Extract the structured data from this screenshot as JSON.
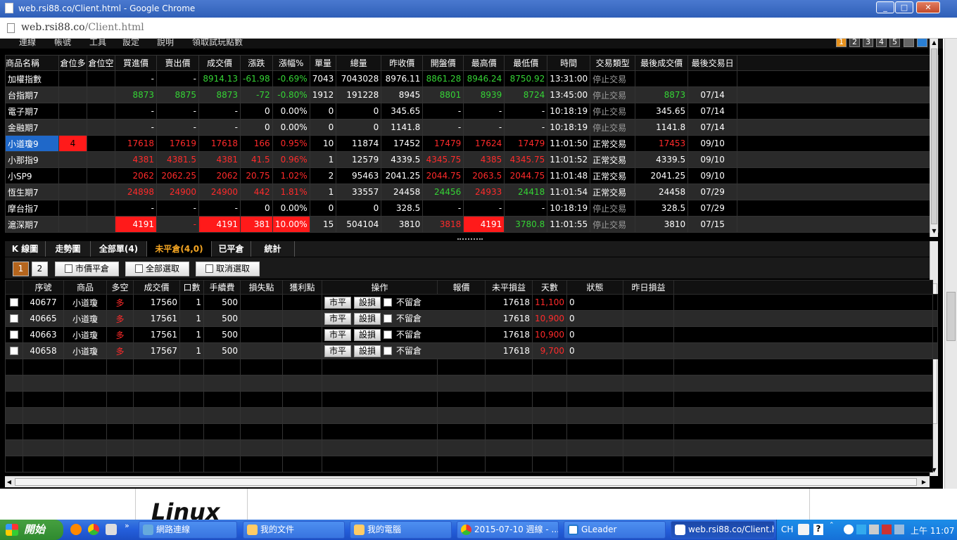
{
  "window": {
    "title": "web.rsi88.co/Client.html - Google Chrome",
    "url_host": "web.rsi88.co",
    "url_path": "/Client.html"
  },
  "menu": {
    "items": [
      "連線",
      "帳號",
      "工具",
      "設定",
      "說明",
      "領取試玩點數"
    ],
    "page_buttons": [
      "1",
      "2",
      "3",
      "4",
      "5"
    ]
  },
  "quotes": {
    "headers": [
      "商品名稱",
      "倉位多",
      "倉位空",
      "買進價",
      "賣出價",
      "成交價",
      "漲跌",
      "漲幅%",
      "單量",
      "總量",
      "昨收價",
      "開盤價",
      "最高價",
      "最低價",
      "時間",
      "交易類型",
      "最後成交價",
      "最後交易日"
    ],
    "rows": [
      {
        "name": "加權指數",
        "long": "",
        "short": "",
        "bid": "-",
        "ask": "-",
        "last": "8914.13",
        "chg": "-61.98",
        "pct": "-0.69%",
        "qty": "7043",
        "vol": "7043028",
        "prev": "8976.11",
        "open": "8861.28",
        "high": "8946.24",
        "low": "8750.92",
        "time": "13:31:00",
        "type": "停止交易",
        "lastp": "",
        "lastd": ""
      },
      {
        "name": "台指期7",
        "long": "",
        "short": "",
        "bid": "8873",
        "ask": "8875",
        "last": "8873",
        "chg": "-72",
        "pct": "-0.80%",
        "qty": "1912",
        "vol": "191228",
        "prev": "8945",
        "open": "8801",
        "high": "8939",
        "low": "8724",
        "time": "13:45:00",
        "type": "停止交易",
        "lastp": "8873",
        "lastd": "07/14"
      },
      {
        "name": "電子期7",
        "long": "",
        "short": "",
        "bid": "-",
        "ask": "-",
        "last": "-",
        "chg": "0",
        "pct": "0.00%",
        "qty": "0",
        "vol": "0",
        "prev": "345.65",
        "open": "-",
        "high": "-",
        "low": "-",
        "time": "10:18:19",
        "type": "停止交易",
        "lastp": "345.65",
        "lastd": "07/14"
      },
      {
        "name": "金融期7",
        "long": "",
        "short": "",
        "bid": "-",
        "ask": "-",
        "last": "-",
        "chg": "0",
        "pct": "0.00%",
        "qty": "0",
        "vol": "0",
        "prev": "1141.8",
        "open": "-",
        "high": "-",
        "low": "-",
        "time": "10:18:19",
        "type": "停止交易",
        "lastp": "1141.8",
        "lastd": "07/14"
      },
      {
        "name": "小道瓊9",
        "long": "4",
        "short": "",
        "bid": "17618",
        "ask": "17619",
        "last": "17618",
        "chg": "166",
        "pct": "0.95%",
        "qty": "10",
        "vol": "11874",
        "prev": "17452",
        "open": "17479",
        "high": "17624",
        "low": "17479",
        "time": "11:01:50",
        "type": "正常交易",
        "lastp": "17453",
        "lastd": "09/10"
      },
      {
        "name": "小那指9",
        "long": "",
        "short": "",
        "bid": "4381",
        "ask": "4381.5",
        "last": "4381",
        "chg": "41.5",
        "pct": "0.96%",
        "qty": "1",
        "vol": "12579",
        "prev": "4339.5",
        "open": "4345.75",
        "high": "4385",
        "low": "4345.75",
        "time": "11:01:52",
        "type": "正常交易",
        "lastp": "4339.5",
        "lastd": "09/10"
      },
      {
        "name": "小SP9",
        "long": "",
        "short": "",
        "bid": "2062",
        "ask": "2062.25",
        "last": "2062",
        "chg": "20.75",
        "pct": "1.02%",
        "qty": "2",
        "vol": "95463",
        "prev": "2041.25",
        "open": "2044.75",
        "high": "2063.5",
        "low": "2044.75",
        "time": "11:01:48",
        "type": "正常交易",
        "lastp": "2041.25",
        "lastd": "09/10"
      },
      {
        "name": "恆生期7",
        "long": "",
        "short": "",
        "bid": "24898",
        "ask": "24900",
        "last": "24900",
        "chg": "442",
        "pct": "1.81%",
        "qty": "1",
        "vol": "33557",
        "prev": "24458",
        "open": "24456",
        "high": "24933",
        "low": "24418",
        "time": "11:01:54",
        "type": "正常交易",
        "lastp": "24458",
        "lastd": "07/29"
      },
      {
        "name": "摩台指7",
        "long": "",
        "short": "",
        "bid": "-",
        "ask": "-",
        "last": "-",
        "chg": "0",
        "pct": "0.00%",
        "qty": "0",
        "vol": "0",
        "prev": "328.5",
        "open": "-",
        "high": "-",
        "low": "-",
        "time": "10:18:19",
        "type": "停止交易",
        "lastp": "328.5",
        "lastd": "07/29"
      },
      {
        "name": "滬深期7",
        "long": "",
        "short": "",
        "bid": "4191",
        "ask": "-",
        "last": "4191",
        "chg": "381",
        "pct": "10.00%",
        "qty": "15",
        "vol": "504104",
        "prev": "3810",
        "open": "3818",
        "high": "4191",
        "low": "3780.8",
        "time": "11:01:55",
        "type": "停止交易",
        "lastp": "3810",
        "lastd": "07/15"
      }
    ]
  },
  "tabs": [
    "K 線圖",
    "走勢圖",
    "全部單(4)",
    "未平倉(4,0)",
    "已平倉",
    "統計"
  ],
  "toolbar": {
    "page1": "1",
    "page2": "2",
    "market_close": "市價平倉",
    "select_all": "全部選取",
    "deselect": "取消選取"
  },
  "positions": {
    "headers": [
      "序號",
      "商品",
      "多空",
      "成交價",
      "口數",
      "手續費",
      "損失點",
      "獲利點",
      "操作",
      "報價",
      "未平損益",
      "天數",
      "狀態",
      "昨日損益"
    ],
    "btn_close": "市平",
    "btn_stop": "設損",
    "keep_label": "不留倉",
    "rows": [
      {
        "id": "40677",
        "product": "小道瓊",
        "side": "多",
        "price": "17560",
        "lots": "1",
        "fee": "500",
        "quote": "17618",
        "pnl": "11,100",
        "days": "0"
      },
      {
        "id": "40665",
        "product": "小道瓊",
        "side": "多",
        "price": "17561",
        "lots": "1",
        "fee": "500",
        "quote": "17618",
        "pnl": "10,900",
        "days": "0"
      },
      {
        "id": "40663",
        "product": "小道瓊",
        "side": "多",
        "price": "17561",
        "lots": "1",
        "fee": "500",
        "quote": "17618",
        "pnl": "10,900",
        "days": "0"
      },
      {
        "id": "40658",
        "product": "小道瓊",
        "side": "多",
        "price": "17567",
        "lots": "1",
        "fee": "500",
        "quote": "17618",
        "pnl": "9,700",
        "days": "0"
      }
    ]
  },
  "below_page": {
    "logo_text": "Linux"
  },
  "taskbar": {
    "start": "開始",
    "items": [
      "網路連線",
      "我的文件",
      "我的電腦",
      "2015-07-10 週線 - ...",
      "GLeader",
      "web.rsi88.co/Client.h..."
    ],
    "lang": "CH",
    "clock": "上午 11:07"
  }
}
